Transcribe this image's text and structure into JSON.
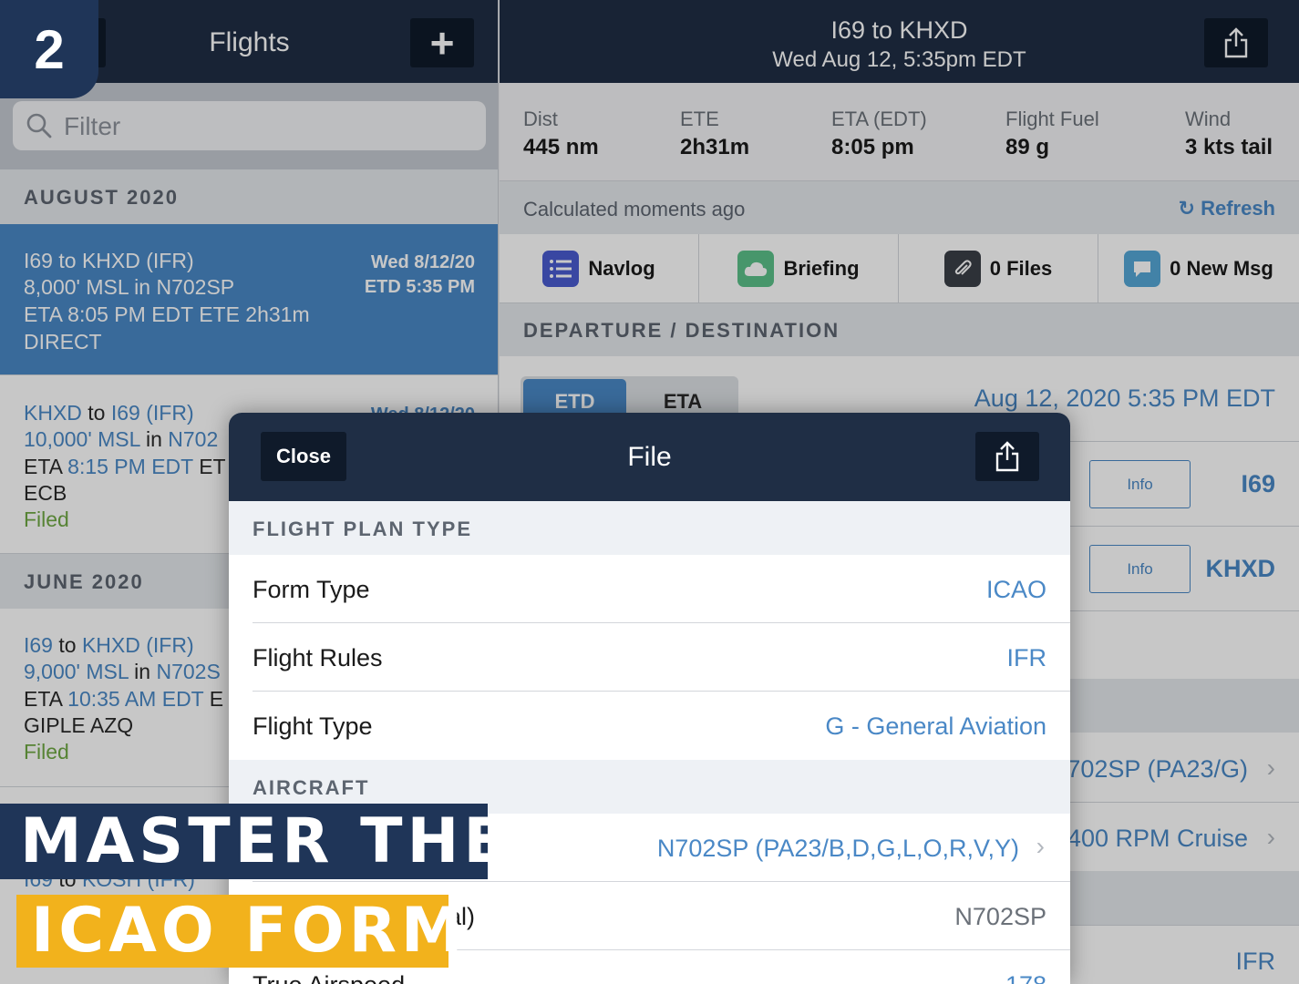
{
  "badge": "2",
  "left": {
    "title": "Flights",
    "add_label": "+",
    "filter_placeholder": "Filter",
    "sections": [
      "AUGUST 2020",
      "JUNE 2020"
    ],
    "flights": [
      {
        "route_from": "I69",
        "to": "to",
        "route_to": "KHXD",
        "rules": "(IFR)",
        "alt": "8,000' MSL",
        "in": "in",
        "tail": "N702SP",
        "eta_label": "ETA",
        "eta": "8:05 PM EDT",
        "ete": "ETE 2h31m",
        "route": "DIRECT",
        "date": "Wed 8/12/20",
        "etd": "ETD 5:35 PM",
        "status": ""
      },
      {
        "route_from": "KHXD",
        "to": "to",
        "route_to": "I69",
        "rules": "(IFR)",
        "alt": "10,000' MSL",
        "in": "in",
        "tail": "N702",
        "eta_label": "ETA",
        "eta": "8:15 PM EDT",
        "ete": "ET",
        "route": "ECB",
        "date": "Wed 8/12/20",
        "status": "Filed"
      },
      {
        "route_from": "I69",
        "to": "to",
        "route_to": "KHXD",
        "rules": "(IFR)",
        "alt": "9,000' MSL",
        "in": "in",
        "tail": "N702S",
        "eta_label": "ETA",
        "eta": "10:35 AM EDT",
        "ete": "E",
        "route": "GIPLE AZQ",
        "status": "Filed"
      },
      {
        "route_from": "I69",
        "to": "to",
        "route_to": "KOSH",
        "rules": "(IFR)"
      }
    ]
  },
  "right": {
    "title": "I69 to KHXD",
    "subtitle": "Wed Aug 12, 5:35pm EDT",
    "stats": [
      {
        "label": "Dist",
        "value": "445 nm"
      },
      {
        "label": "ETE",
        "value": "2h31m"
      },
      {
        "label": "ETA (EDT)",
        "value": "8:05 pm"
      },
      {
        "label": "Flight Fuel",
        "value": "89 g"
      },
      {
        "label": "Wind",
        "value": "3 kts tail"
      }
    ],
    "calc_text": "Calculated moments ago",
    "refresh": "Refresh",
    "tiles": [
      {
        "label": "Navlog",
        "color": "#4a5bd0",
        "icon": "list-icon"
      },
      {
        "label": "Briefing",
        "color": "#5cc08a",
        "icon": "cloud-icon"
      },
      {
        "label": "0 Files",
        "color": "#3a3f47",
        "icon": "paperclip-icon"
      },
      {
        "label": "0 New Msg",
        "color": "#55a7d6",
        "icon": "message-icon"
      }
    ],
    "dep_dest_header": "DEPARTURE / DESTINATION",
    "seg": [
      "ETD",
      "ETA"
    ],
    "dep_date": "Aug 12, 2020 5:35 PM EDT",
    "info": "Info",
    "departure": "I69",
    "destination": "KHXD",
    "aircraft_partial": "702SP (PA23/G)",
    "profile_partial": "400 RPM Cruise",
    "rules_partial": "IFR"
  },
  "modal": {
    "close": "Close",
    "title": "File",
    "sec_type": "FLIGHT PLAN TYPE",
    "rows_type": [
      {
        "label": "Form Type",
        "value": "ICAO"
      },
      {
        "label": "Flight Rules",
        "value": "IFR"
      },
      {
        "label": "Flight Type",
        "value": "G - General Aviation"
      }
    ],
    "sec_aircraft": "AIRCRAFT",
    "aircraft_value": "N702SP (PA23/B,D,G,L,O,R,V,Y)",
    "callsign_label_partial": "al)",
    "callsign_value": "N702SP",
    "tas_label_partial": "True Airspeed",
    "tas_value_partial": "178"
  },
  "banner": {
    "line1": "MASTER THE",
    "line2": "ICAO FORM"
  },
  "colors": {
    "navy": "#1f2e45",
    "accent": "#4a88c6",
    "gold": "#f2b21c",
    "filed": "#6fa843"
  }
}
